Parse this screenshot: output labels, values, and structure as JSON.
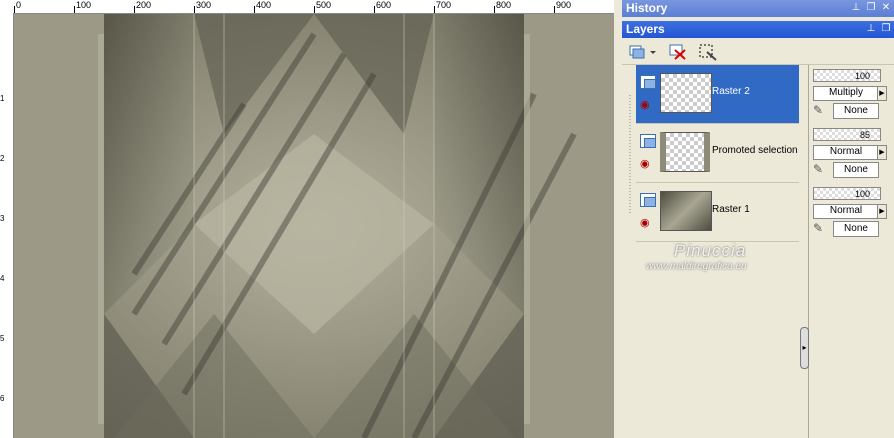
{
  "ruler": {
    "top_labels": [
      "0",
      "100",
      "200",
      "300",
      "400",
      "500",
      "600",
      "700",
      "800",
      "900"
    ],
    "left_labels": [
      "1",
      "2",
      "3",
      "4",
      "5",
      "6"
    ]
  },
  "palettes": {
    "history_title": "History",
    "layers_title": "Layers"
  },
  "layers": [
    {
      "name": "Raster 2",
      "opacity": "100",
      "blend": "Multiply",
      "mask": "None",
      "selected": true
    },
    {
      "name": "Promoted selection",
      "opacity": "85",
      "blend": "Normal",
      "mask": "None",
      "selected": false
    },
    {
      "name": "Raster 1",
      "opacity": "100",
      "blend": "Normal",
      "mask": "None",
      "selected": false
    }
  ],
  "watermark": {
    "name": "Pinuccia",
    "url": "www.maldiregrafica.eu"
  },
  "colors": {
    "canvas_base": "#8e8c78",
    "selection": "#316ac5",
    "titlebar": "#5b7fd4"
  },
  "icons": [
    "new-layer-icon",
    "delete-layer-icon",
    "edit-selection-icon",
    "eye-icon",
    "lock-icon"
  ]
}
